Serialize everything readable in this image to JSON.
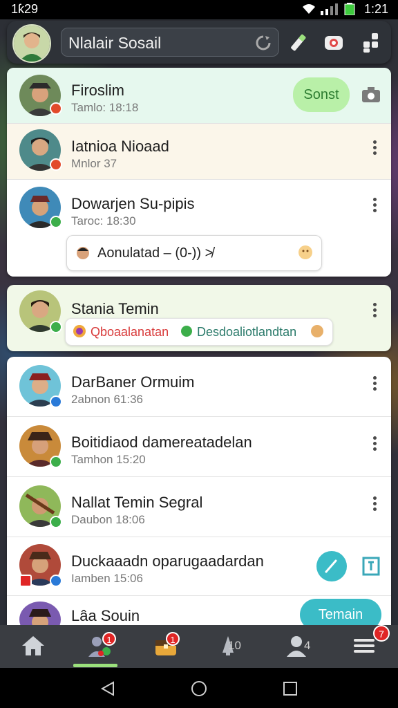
{
  "status_bar": {
    "time_left": "1ƙ29",
    "time_right": "1:21"
  },
  "app_bar": {
    "title": "Nlalair Sosail"
  },
  "contacts": [
    {
      "name": "Firoslim",
      "sub": "Tamlo: 18:18",
      "action_label": "Sonst"
    },
    {
      "name": "Iatnioa Nioaad",
      "sub": "Mnlor 37"
    },
    {
      "name": "Dowarjen Su-pipis",
      "sub": "Taroc: 18:30",
      "bubble": "Aonulatad – (0-)) ≯"
    },
    {
      "name": "Stania Temin",
      "bubble_left": "Qboaalanatan",
      "bubble_right": "Desdoaliotlandtan"
    },
    {
      "name": "DarBaner Ormuim",
      "sub": "2abnon 61:36"
    },
    {
      "name": "Boitidiaod damereatadelan",
      "sub": "Tamhon 15:20"
    },
    {
      "name": "Nallat Temin Segral",
      "sub": "Daubon 18:06"
    },
    {
      "name": "Duckaaadn oparugaadardan",
      "sub": "Iamben 15:06"
    },
    {
      "name": "Lâa Souin",
      "action_label": "Temain"
    }
  ],
  "bottom_nav": {
    "home": "home-icon",
    "friends_badge": "1",
    "chest_badge": "1",
    "alerts_count": "10",
    "profile_count": "4",
    "menu_badge": "7"
  },
  "colors": {
    "accent_green": "#9be07c",
    "highlight_row": "#e6f8ee",
    "cream_row": "#fbf6ea",
    "teal_fab": "#3bbcc7",
    "badge_red": "#e02525"
  }
}
